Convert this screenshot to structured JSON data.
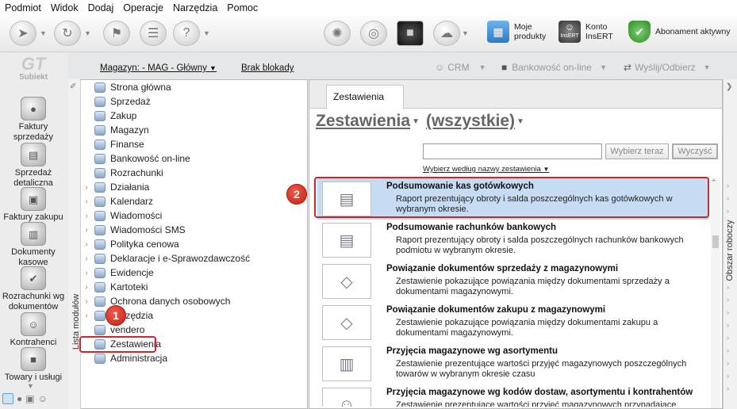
{
  "menu": [
    "Podmiot",
    "Widok",
    "Dodaj",
    "Operacje",
    "Narzędzia",
    "Pomoc"
  ],
  "toolbar": {
    "moje_produkty": [
      "Moje",
      "produkty"
    ],
    "konto": [
      "Konto",
      "InsERT"
    ],
    "insert_logo": "InsERT",
    "abonament": "Abonament aktywny"
  },
  "app_logo": "Subiekt",
  "leftnav": [
    {
      "label": "Faktury sprzedaży",
      "lines": [
        "Faktury",
        "sprzedaży"
      ]
    },
    {
      "label": "Sprzedaż detaliczna",
      "lines": [
        "Sprzedaż",
        "detaliczna"
      ]
    },
    {
      "label": "Faktury zakupu",
      "lines": [
        "Faktury zakupu"
      ]
    },
    {
      "label": "Dokumenty kasowe",
      "lines": [
        "Dokumenty",
        "kasowe"
      ]
    },
    {
      "label": "Rozrachunki wg dokumentów",
      "lines": [
        "Rozrachunki wg",
        "dokumentów"
      ]
    },
    {
      "label": "Kontrahenci",
      "lines": [
        "Kontrahenci"
      ]
    },
    {
      "label": "Towary i usługi",
      "lines": [
        "Towary i usługi"
      ]
    }
  ],
  "topbar": {
    "magazyn": "Magazyn: - MAG - Główny",
    "blokada": "Brak blokady",
    "crm": "CRM",
    "bankowosc": "Bankowość on-line",
    "wyslij": "Wyślij/Odbierz"
  },
  "modules_tab": "Lista modułów",
  "modules": [
    {
      "label": "Strona główna",
      "chev": false
    },
    {
      "label": "Sprzedaż",
      "chev": false
    },
    {
      "label": "Zakup",
      "chev": false
    },
    {
      "label": "Magazyn",
      "chev": false
    },
    {
      "label": "Finanse",
      "chev": false
    },
    {
      "label": "Bankowość on-line",
      "chev": false
    },
    {
      "label": "Rozrachunki",
      "chev": false
    },
    {
      "label": "Działania",
      "chev": true
    },
    {
      "label": "Kalendarz",
      "chev": true
    },
    {
      "label": "Wiadomości",
      "chev": true
    },
    {
      "label": "Wiadomości SMS",
      "chev": true
    },
    {
      "label": "Polityka cenowa",
      "chev": true
    },
    {
      "label": "Deklaracje i e-Sprawozdawczość",
      "chev": true
    },
    {
      "label": "Ewidencje",
      "chev": true
    },
    {
      "label": "Kartoteki",
      "chev": true
    },
    {
      "label": "Ochrona danych osobowych",
      "chev": true
    },
    {
      "label": "Narzędzia",
      "chev": true
    },
    {
      "label": "vendero",
      "chev": false
    },
    {
      "label": "Zestawienia",
      "chev": false
    },
    {
      "label": "Administracja",
      "chev": false
    }
  ],
  "tab_label": "Zestawienia",
  "heading": {
    "main": "Zestawienia",
    "filter": "(wszystkie)"
  },
  "search": {
    "value": "",
    "select_label": "Wybierz teraz",
    "clear_label": "Wyczyść",
    "sort_label": "Wybierz według nazwy zestawienia"
  },
  "reports": [
    {
      "title": "Podsumowanie kas gotówkowych",
      "desc": "Raport prezentujący obroty i salda poszczególnych kas gotówkowych w wybranym okresie.",
      "selected": true
    },
    {
      "title": "Podsumowanie rachunków bankowych",
      "desc": "Raport prezentujący obroty i salda poszczególnych rachunków bankowych podmiotu w wybranym okresie.",
      "selected": false
    },
    {
      "title": "Powiązanie dokumentów sprzedaży z magazynowymi",
      "desc": "Zestawienie pokazujące powiązania między dokumentami sprzedaży a dokumentami magazynowymi.",
      "selected": false
    },
    {
      "title": "Powiązanie dokumentów zakupu z magazynowymi",
      "desc": "Zestawienie pokazujące powiązania między dokumentami zakupu a dokumentami magazynowymi.",
      "selected": false
    },
    {
      "title": "Przyjęcia magazynowe wg asortymentu",
      "desc": "Zestawienie prezentujące wartości przyjęć magazynowych poszczególnych towarów w wybranym okresie czasu",
      "selected": false
    },
    {
      "title": "Przyjęcia magazynowe wg kodów dostaw, asortymentu i kontrahentów",
      "desc": "Zestawienie prezentujące wartości przyjęć magazynowych przypadające",
      "selected": false
    }
  ],
  "right_strip": "Obszar roboczy",
  "badges": [
    "1",
    "2"
  ],
  "colors": {
    "selected_row": "#c5dcf3",
    "highlight_border": "#d0252a",
    "badge": "#d93a2b"
  }
}
